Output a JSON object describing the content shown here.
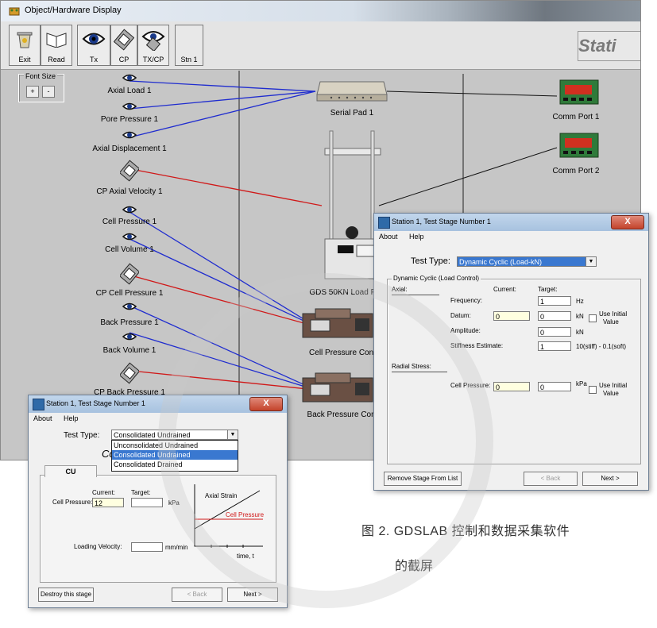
{
  "main_window": {
    "title": "Object/Hardware Display",
    "toolbar": [
      {
        "label": "Exit",
        "icon": "bin-icon"
      },
      {
        "label": "Read",
        "icon": "book-icon"
      },
      {
        "label": "Tx",
        "icon": "eye-icon"
      },
      {
        "label": "CP",
        "icon": "valve-icon"
      },
      {
        "label": "TX/CP",
        "icon": "eye-valve-icon"
      },
      {
        "label": "Stn 1",
        "icon": ""
      }
    ],
    "brand_text": "Stati",
    "font_size": {
      "label": "Font Size",
      "plus": "+",
      "minus": "-"
    },
    "left_nodes": [
      "Axial Load 1",
      "Pore Pressure 1",
      "Axial Displacement 1",
      "CP Axial Velocity 1",
      "Cell Pressure 1",
      "Cell Volume 1",
      "CP Cell Pressure 1",
      "Back Pressure 1",
      "Back Volume 1",
      "CP Back Pressure 1"
    ],
    "devices": {
      "serial_pad": "Serial Pad 1",
      "load_frame": "GDS 50KN Load F",
      "cell_pressure_ctrl": "Cell Pressure Cont",
      "back_pressure_ctrl": "Back Pressure Cont",
      "comm_port_1": "Comm Port 1",
      "comm_port_2": "Comm Port 2"
    },
    "colors": {
      "blue_link": "#1f2ccf",
      "red_link": "#d01818"
    }
  },
  "dialog_cyclic": {
    "title": "Station 1, Test Stage Number 1",
    "close": "X",
    "menu": [
      "About",
      "Help"
    ],
    "test_type_label": "Test Type:",
    "test_type_value": "Dynamic Cyclic (Load-kN)",
    "group_label": "Dynamic Cyclic (Load Control)",
    "axial_label": "Axial:",
    "current_label": "Current:",
    "target_label": "Target:",
    "frequency_label": "Frequency:",
    "frequency_value": "1",
    "frequency_unit": "Hz",
    "datum_label": "Datum:",
    "datum_current": "0",
    "datum_target": "0",
    "datum_unit": "kN",
    "use_initial": "Use Initial",
    "use_initial_2": "Value",
    "amplitude_label": "Amplitude:",
    "amplitude_value": "0",
    "amplitude_unit": "kN",
    "stiffness_label": "Stiffness Estimate:",
    "stiffness_value": "1",
    "stiffness_range": "10(stiff) - 0.1(soft)",
    "radial_label": "Radial Stress:",
    "cell_pressure_label": "Cell Pressure:",
    "cell_current": "0",
    "cell_target": "0",
    "cell_unit": "kPa",
    "remove_button": "Remove Stage From List",
    "back_button": "< Back",
    "next_button": "Next >"
  },
  "dialog_cu": {
    "title": "Station 1, Test Stage Number 1",
    "close": "X",
    "menu": [
      "About",
      "Help"
    ],
    "test_type_label": "Test Type:",
    "test_type_value": "Consolidated Undrained",
    "options": [
      "Unconsolidated Undrained",
      "Consolidated Undrained",
      "Consolidated Drained"
    ],
    "partial_heading": "Co",
    "tab_label": "CU",
    "current_label": "Current:",
    "target_label": "Target:",
    "cell_pressure_label": "Cell Pressure:",
    "cell_current": "12",
    "cell_unit": "kPa",
    "loading_velocity_label": "Loading Velocity:",
    "loading_velocity_unit": "mm/min",
    "graph_axial": "Axial Strain",
    "graph_cell": "Cell Pressure",
    "graph_time": "time, t",
    "destroy_button": "Destroy this stage",
    "back_button": "< Back",
    "next_button": "Next >"
  },
  "caption": {
    "line1": "图 2. GDSLAB 控制和数据采集软件",
    "line2": "的截屏"
  }
}
